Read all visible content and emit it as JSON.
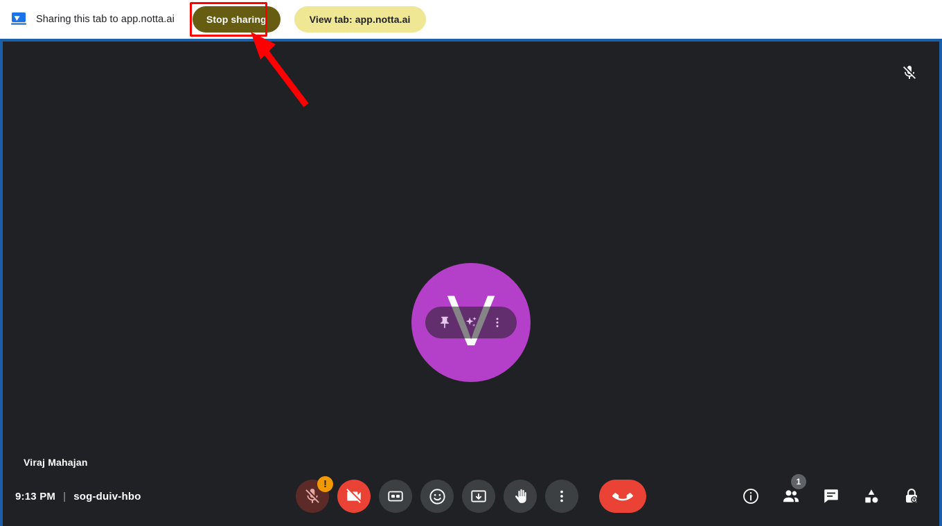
{
  "share_bar": {
    "icon_name": "screen-share-icon",
    "message": "Sharing this tab to app.notta.ai",
    "stop_button_label": "Stop sharing",
    "view_button_label": "View tab: app.notta.ai",
    "highlight_color": "#ff0000",
    "stop_button_color": "#665c12",
    "view_button_color": "#efe794"
  },
  "annotation": {
    "type": "arrow",
    "color": "#ff0000",
    "points_to": "Stop sharing"
  },
  "shared_tab": {
    "border_color": "#1b5fa8",
    "background_color": "#202124",
    "app": "Google Meet"
  },
  "stage": {
    "mic_status_icon": "mic-off-icon",
    "participant": {
      "name": "Viraj Mahajan",
      "avatar_letter": "V",
      "avatar_color": "#b43fc8",
      "hover_actions": [
        {
          "name": "pin-icon",
          "label": "Pin"
        },
        {
          "name": "sparkle-icon",
          "label": "Visual effects"
        },
        {
          "name": "more-vert-icon",
          "label": "More options"
        }
      ]
    }
  },
  "bottom_bar": {
    "time": "9:13 PM",
    "separator": "|",
    "meeting_code": "sog-duiv-hbo",
    "center_controls": [
      {
        "name": "microphone-off-button",
        "label": "Turn on microphone",
        "state": "muted",
        "badge": "!",
        "color": "#5c2b27"
      },
      {
        "name": "camera-off-button",
        "label": "Turn on camera",
        "state": "off",
        "color": "#ea4335"
      },
      {
        "name": "captions-button",
        "label": "Turn on captions",
        "color": "#3c4043"
      },
      {
        "name": "reactions-button",
        "label": "Send a reaction",
        "color": "#3c4043"
      },
      {
        "name": "present-button",
        "label": "Present now",
        "color": "#3c4043"
      },
      {
        "name": "raise-hand-button",
        "label": "Raise hand",
        "color": "#3c4043"
      },
      {
        "name": "more-options-button",
        "label": "More options",
        "color": "#3c4043"
      },
      {
        "name": "leave-call-button",
        "label": "Leave call",
        "color": "#ea4335"
      }
    ],
    "right_controls": [
      {
        "name": "meeting-details-button",
        "label": "Meeting details",
        "badge": ""
      },
      {
        "name": "people-button",
        "label": "People",
        "badge": "1"
      },
      {
        "name": "chat-button",
        "label": "Chat with everyone",
        "badge": ""
      },
      {
        "name": "activities-button",
        "label": "Activities",
        "badge": ""
      },
      {
        "name": "host-controls-button",
        "label": "Host controls",
        "badge": ""
      }
    ]
  }
}
